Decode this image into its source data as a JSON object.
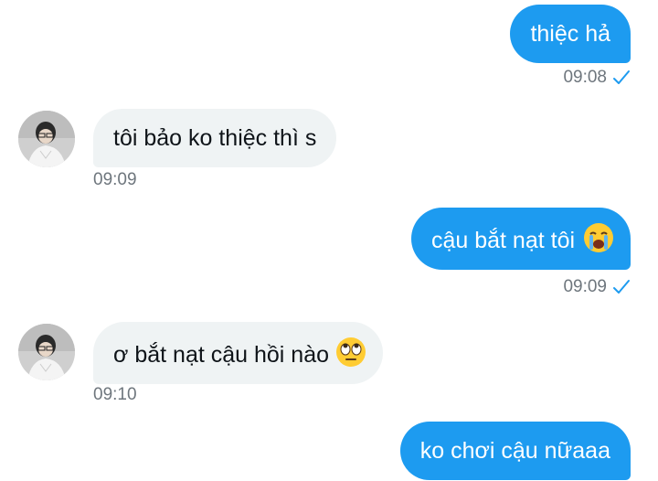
{
  "messages": [
    {
      "direction": "out",
      "text": "thiệc hả",
      "time": "09:08",
      "read": true
    },
    {
      "direction": "in",
      "text": "tôi bảo ko thiệc thì s",
      "time": "09:09"
    },
    {
      "direction": "out",
      "text": "cậu bắt nạt tôi",
      "emoji": "crying-face",
      "time": "09:09",
      "read": true
    },
    {
      "direction": "in",
      "text": "ơ bắt nạt cậu hồi nào",
      "emoji": "eye-roll-face",
      "time": "09:10"
    },
    {
      "direction": "out",
      "text": "ko chơi cậu nữaaa"
    }
  ],
  "colors": {
    "outgoing_bubble": "#1d9bf0",
    "incoming_bubble": "#eff3f4",
    "timestamp": "#6e767d",
    "read_check": "#1d9bf0"
  },
  "icons": {
    "read_receipt": "check-icon",
    "contact_avatar": "avatar-photo"
  }
}
